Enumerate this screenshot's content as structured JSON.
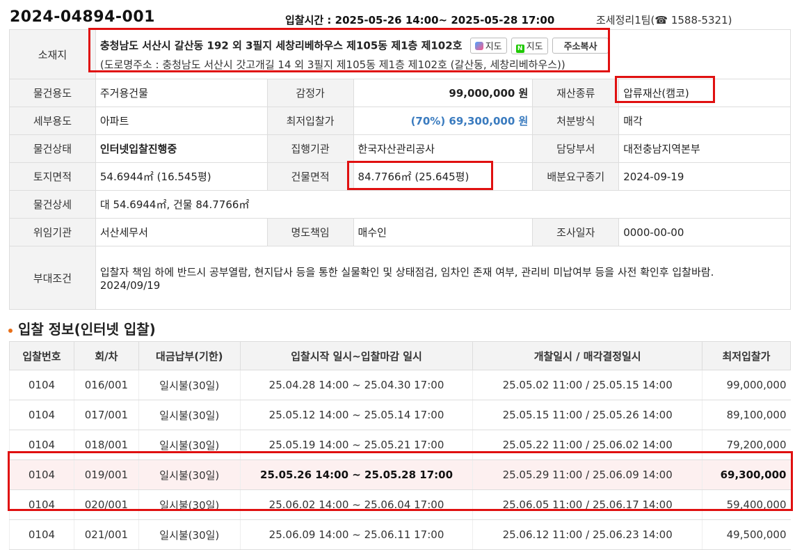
{
  "header": {
    "case_no": "2024-04894-001",
    "bid_time": "입찰시간 : 2025-05-26 14:00~ 2025-05-28 17:00",
    "team": "조세정리1팀(☎ 1588-5321)"
  },
  "info": {
    "address_label": "소재지",
    "address_main": "충청남도 서산시 갈산동 192 외 3필지 세창리베하우스 제105동 제1층 제102호",
    "address_road": "(도로명주소 : 충청남도 서산시 갓고개길 14 외 3필지 제105동 제1층 제102호 (갈산동, 세창리베하우스))",
    "map_daum_label": "지도",
    "map_naver_label": "지도",
    "copy_label": "주소복사",
    "usage_label": "물건용도",
    "usage": "주거용건물",
    "appraisal_label": "감정가",
    "appraisal": "99,000,000 원",
    "asset_type_label": "재산종류",
    "asset_type": "압류재산(캠코)",
    "sub_usage_label": "세부용도",
    "sub_usage": "아파트",
    "min_bid_label": "최저입찰가",
    "min_bid": "(70%) 69,300,000 원",
    "disposal_label": "처분방식",
    "disposal": "매각",
    "status_label": "물건상태",
    "status": "인터넷입찰진행중",
    "agency_label": "집행기관",
    "agency": "한국자산관리공사",
    "dept_label": "담당부서",
    "dept": "대전충남지역본부",
    "land_area_label": "토지면적",
    "land_area": "54.6944㎡ (16.545평)",
    "bldg_area_label": "건물면적",
    "bldg_area": "84.7766㎡ (25.645평)",
    "deadline_label": "배분요구종기",
    "deadline": "2024-09-19",
    "detail_label": "물건상세",
    "detail": "대 54.6944㎡, 건물 84.7766㎡",
    "delegate_label": "위임기관",
    "delegate": "서산세무서",
    "liability_label": "명도책임",
    "liability": "매수인",
    "survey_label": "조사일자",
    "survey": "0000-00-00",
    "condition_label": "부대조건",
    "condition": " 입찰자 책임 하에 반드시 공부열람, 현지답사 등을 통한 실물확인 및 상태점검, 임차인 존재 여부, 관리비 미납여부 등을 사전 확인후 입찰바람.",
    "condition_date": "2024/09/19"
  },
  "bids": {
    "title": "입찰 정보(인터넷 입찰)",
    "headers": [
      "입찰번호",
      "회/차",
      "대금납부(기한)",
      "입찰시작 일시~입찰마감 일시",
      "개찰일시 / 매각결정일시",
      "최저입찰가"
    ],
    "rows": [
      [
        "0104",
        "016/001",
        "일시불(30일)",
        "25.04.28 14:00 ~ 25.04.30 17:00",
        "25.05.02 11:00 / 25.05.15 14:00",
        "99,000,000"
      ],
      [
        "0104",
        "017/001",
        "일시불(30일)",
        "25.05.12 14:00 ~ 25.05.14 17:00",
        "25.05.15 11:00 / 25.05.26 14:00",
        "89,100,000"
      ],
      [
        "0104",
        "018/001",
        "일시불(30일)",
        "25.05.19 14:00 ~ 25.05.21 17:00",
        "25.05.22 11:00 / 25.06.02 14:00",
        "79,200,000"
      ],
      [
        "0104",
        "019/001",
        "일시불(30일)",
        "25.05.26 14:00 ~ 25.05.28 17:00",
        "25.05.29 11:00 / 25.06.09 14:00",
        "69,300,000"
      ],
      [
        "0104",
        "020/001",
        "일시불(30일)",
        "25.06.02 14:00 ~ 25.06.04 17:00",
        "25.06.05 11:00 / 25.06.17 14:00",
        "59,400,000"
      ],
      [
        "0104",
        "021/001",
        "일시불(30일)",
        "25.06.09 14:00 ~ 25.06.11 17:00",
        "25.06.12 11:00 / 25.06.23 14:00",
        "49,500,000"
      ]
    ]
  },
  "colors": {
    "highlight": "#e01010",
    "accent_blue": "#3a7bbf",
    "current_row_bg": "#fdf0f0",
    "section_dot": "#e8701a"
  }
}
